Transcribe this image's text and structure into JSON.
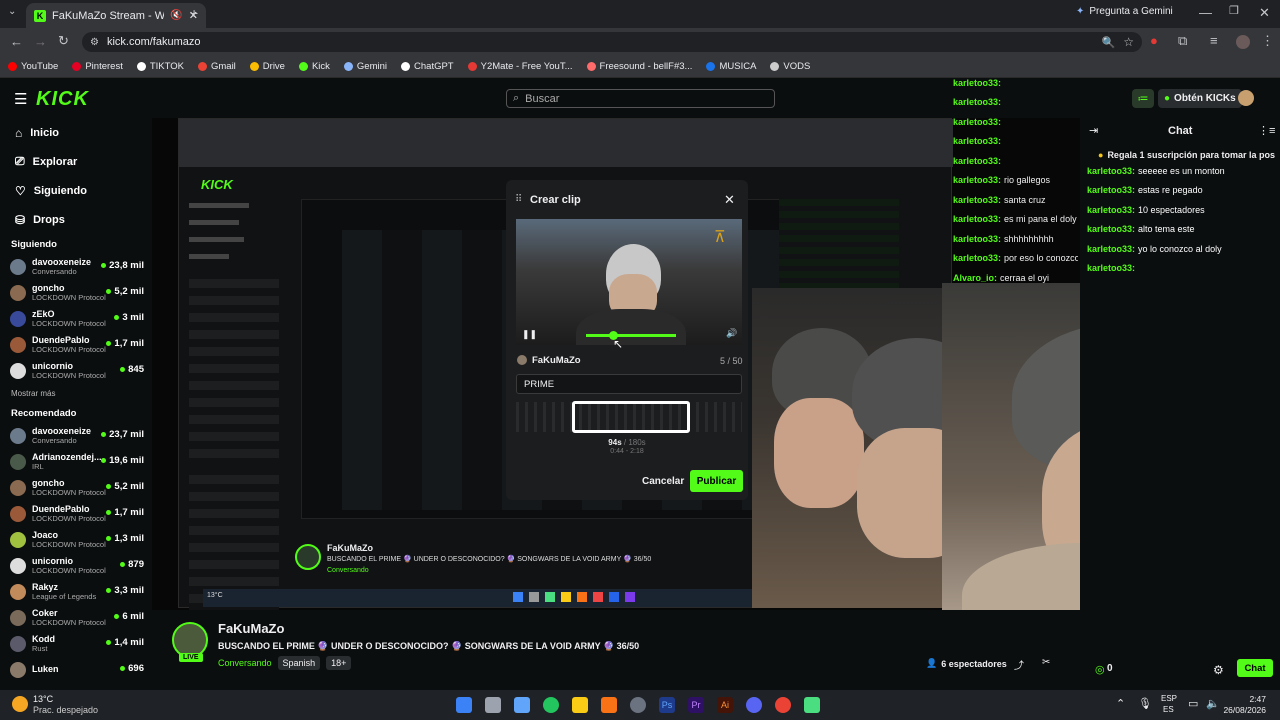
{
  "browser": {
    "tab_title": "FaKuMaZo Stream - Watch",
    "new_tab": "+",
    "address": "kick.com/fakumazo",
    "gemini_label": "Pregunta a Gemini",
    "bookmarks": [
      "YouTube",
      "Pinterest",
      "TIKTOK",
      "Gmail",
      "Drive",
      "Kick",
      "Gemini",
      "ChatGPT",
      "Y2Mate - Free YouT...",
      "Freesound - bellF#3...",
      "MUSICA",
      "VODS"
    ],
    "bookmark_colors": [
      "#ff0000",
      "#e60023",
      "#ffffff",
      "#ea4335",
      "#fbbc04",
      "#53fc18",
      "#8ab4f8",
      "#ffffff",
      "#e53935",
      "#ff6b6b",
      "#1a73e8",
      "#cccccc"
    ]
  },
  "header": {
    "logo": "KICK",
    "search_placeholder": "Buscar",
    "kicks_label": "Obtén KICKs"
  },
  "sidebar": {
    "nav": [
      {
        "label": "Inicio",
        "icon": "home-icon"
      },
      {
        "label": "Explorar",
        "icon": "compass-icon"
      },
      {
        "label": "Siguiendo",
        "icon": "heart-icon"
      },
      {
        "label": "Drops",
        "icon": "drops-icon"
      }
    ],
    "following_title": "Siguiendo",
    "following": [
      {
        "name": "davooxeneize",
        "cat": "Conversando",
        "count": "23,8 mil",
        "color": "#6b7b8c"
      },
      {
        "name": "goncho",
        "cat": "LOCKDOWN Protocol",
        "count": "5,2 mil",
        "color": "#8a6a50"
      },
      {
        "name": "zEkO",
        "cat": "LOCKDOWN Protocol",
        "count": "3 mil",
        "color": "#3a4a9a"
      },
      {
        "name": "DuendePablo",
        "cat": "LOCKDOWN Protocol",
        "count": "1,7 mil",
        "color": "#9a5a3a"
      },
      {
        "name": "unicornio",
        "cat": "LOCKDOWN Protocol",
        "count": "845",
        "color": "#dddddd"
      }
    ],
    "show_more": "Mostrar más",
    "recommended_title": "Recomendado",
    "recommended": [
      {
        "name": "davooxeneize",
        "cat": "Conversando",
        "count": "23,7 mil",
        "color": "#6b7b8c"
      },
      {
        "name": "Adrianozendej...",
        "cat": "IRL",
        "count": "19,6 mil",
        "color": "#4a5a4a"
      },
      {
        "name": "goncho",
        "cat": "LOCKDOWN Protocol",
        "count": "5,2 mil",
        "color": "#8a6a50"
      },
      {
        "name": "DuendePablo",
        "cat": "LOCKDOWN Protocol",
        "count": "1,7 mil",
        "color": "#9a5a3a"
      },
      {
        "name": "Joaco",
        "cat": "LOCKDOWN Protocol",
        "count": "1,3 mil",
        "color": "#a0c040"
      },
      {
        "name": "unicornio",
        "cat": "LOCKDOWN Protocol",
        "count": "879",
        "color": "#dddddd"
      },
      {
        "name": "Rakyz",
        "cat": "League of Legends",
        "count": "3,3 mil",
        "color": "#c08a5a"
      },
      {
        "name": "Coker",
        "cat": "LOCKDOWN Protocol",
        "count": "6 mil",
        "color": "#7a6a5a"
      },
      {
        "name": "Kodd",
        "cat": "Rust",
        "count": "1,4 mil",
        "color": "#5a5a6a"
      },
      {
        "name": "Luken",
        "cat": "",
        "count": "696",
        "color": "#8a7a6a"
      }
    ]
  },
  "clip_modal": {
    "title": "Crear clip",
    "channel": "FaKuMaZo",
    "char_count": "5 / 50",
    "title_value": "PRIME",
    "duration": "94s",
    "duration_max": "/ 180s",
    "range": "0:44 - 2:18",
    "progress": 0.3,
    "cancel": "Cancelar",
    "publish": "Publicar"
  },
  "stream": {
    "channel": "FaKuMaZo",
    "live_badge": "LIVE",
    "title": "BUSCANDO EL PRIME 🔮 UNDER O DESCONOCIDO? 🔮 SONGWARS DE LA VOID ARMY 🔮 36/50",
    "category": "Conversando",
    "tags": [
      "Spanish",
      "18+"
    ],
    "viewers": "6 espectadores",
    "kicks": "0"
  },
  "chat": {
    "title": "Chat",
    "gift_banner": "Regala 1 suscripción para tomar la pos",
    "messages": [
      {
        "user": "karletoo33:",
        "text": "seeeee es un monton"
      },
      {
        "user": "karletoo33:",
        "text": "estas re pegado"
      },
      {
        "user": "karletoo33:",
        "text": "10 espectadores"
      },
      {
        "user": "karletoo33:",
        "text": "alto tema este"
      },
      {
        "user": "karletoo33:",
        "text": "yo lo conozco al doly"
      },
      {
        "user": "karletoo33:",
        "text": ""
      }
    ],
    "send": "Chat"
  },
  "overlay_chat": [
    {
      "user": "karletoo33:",
      "text": ""
    },
    {
      "user": "karletoo33:",
      "text": ""
    },
    {
      "user": "karletoo33:",
      "text": ""
    },
    {
      "user": "karletoo33:",
      "text": ""
    },
    {
      "user": "karletoo33:",
      "text": ""
    },
    {
      "user": "karletoo33:",
      "text": "rio gallegos"
    },
    {
      "user": "karletoo33:",
      "text": "santa cruz"
    },
    {
      "user": "karletoo33:",
      "text": "es mi pana el doly jaja"
    },
    {
      "user": "karletoo33:",
      "text": "shhhhhhhhh"
    },
    {
      "user": "karletoo33:",
      "text": "por eso lo conozco"
    },
    {
      "user": "Alvaro_io:",
      "text": "cerraa el oyi"
    }
  ],
  "taskbar": {
    "weather_temp": "13°C",
    "weather_desc": "Prac. despejado",
    "lang": "ESP",
    "lang2": "ES",
    "time": "2:47",
    "date": "26/08/2026"
  }
}
